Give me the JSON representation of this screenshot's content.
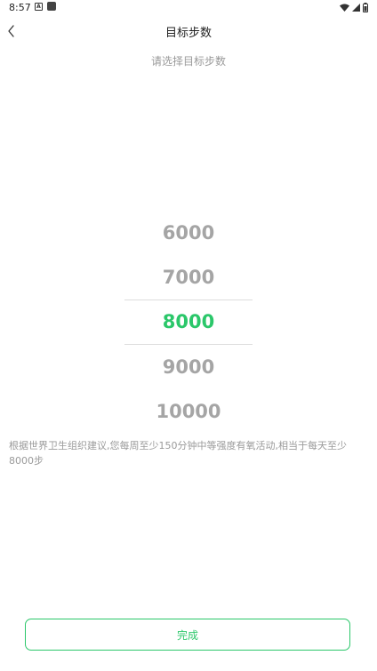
{
  "status_bar": {
    "time": "8:57",
    "notif_a_label": "A",
    "icons": [
      "wifi-icon",
      "signal-icon",
      "battery-icon"
    ]
  },
  "header": {
    "title": "目标步数",
    "back_icon": "chevron-left-icon"
  },
  "subtitle": "请选择目标步数",
  "picker": {
    "options": [
      "6000",
      "7000",
      "8000",
      "9000",
      "10000"
    ],
    "selected": "8000"
  },
  "description": "根据世界卫生组织建议,您每周至少150分钟中等强度有氧活动,相当于每天至少8000步",
  "footer": {
    "done_label": "完成"
  },
  "colors": {
    "accent": "#2bc76a",
    "muted_text": "#9a9a9a",
    "option_text": "#a5a5a5"
  }
}
